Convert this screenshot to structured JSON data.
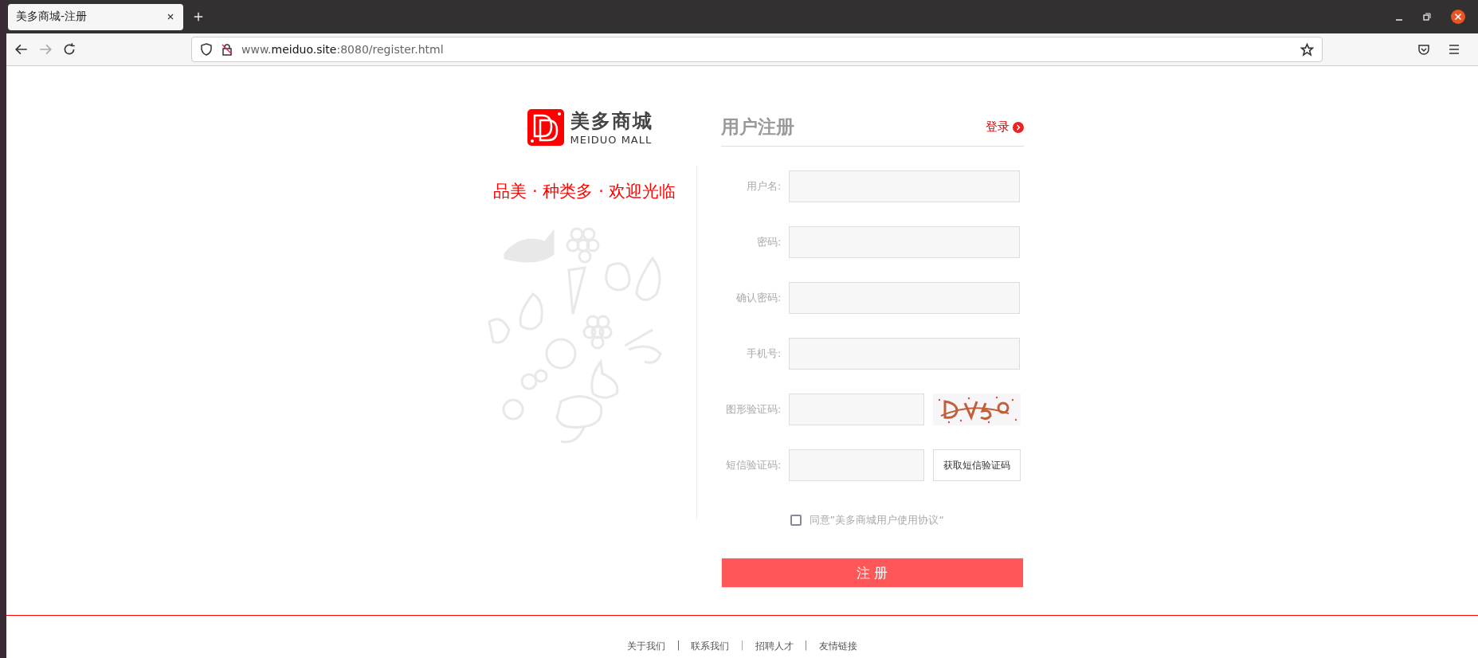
{
  "browser": {
    "tab": {
      "title": "美多商城-注册",
      "selected": true
    },
    "address": "www.**meiduo.site**:8080/register.html",
    "forward_disabled": true
  },
  "logo": {
    "name": "美多商城",
    "subtitle": "MEIDUO MALL"
  },
  "slogan": "品美 · 种类多 · 欢迎光临",
  "form": {
    "title": "用户注册",
    "login_link": "登录",
    "rows": [
      {
        "kind": "input",
        "label": "用户名:"
      },
      {
        "kind": "input",
        "label": "密码:"
      },
      {
        "kind": "input",
        "label": "确认密码:"
      },
      {
        "kind": "input",
        "label": "手机号:"
      },
      {
        "kind": "captcha",
        "label": "图形验证码:"
      },
      {
        "kind": "sms",
        "label": "短信验证码:",
        "button": "获取短信验证码"
      }
    ],
    "agree": {
      "checked": false,
      "label": "同意”美多商城用户使用协议“"
    },
    "submit": "注 册"
  },
  "footer": {
    "items": [
      {
        "kind": "link",
        "text": "关于我们"
      },
      {
        "kind": "separator",
        "text": "|",
        "color": "#5a5aa0"
      },
      {
        "kind": "link",
        "text": "联系我们"
      },
      {
        "kind": "separator",
        "text": "|",
        "color": "#e0a040"
      },
      {
        "kind": "link",
        "text": "招聘人才"
      },
      {
        "kind": "separator",
        "text": "|",
        "color": "#40a0c0"
      },
      {
        "kind": "link",
        "text": "友情链接"
      }
    ]
  }
}
